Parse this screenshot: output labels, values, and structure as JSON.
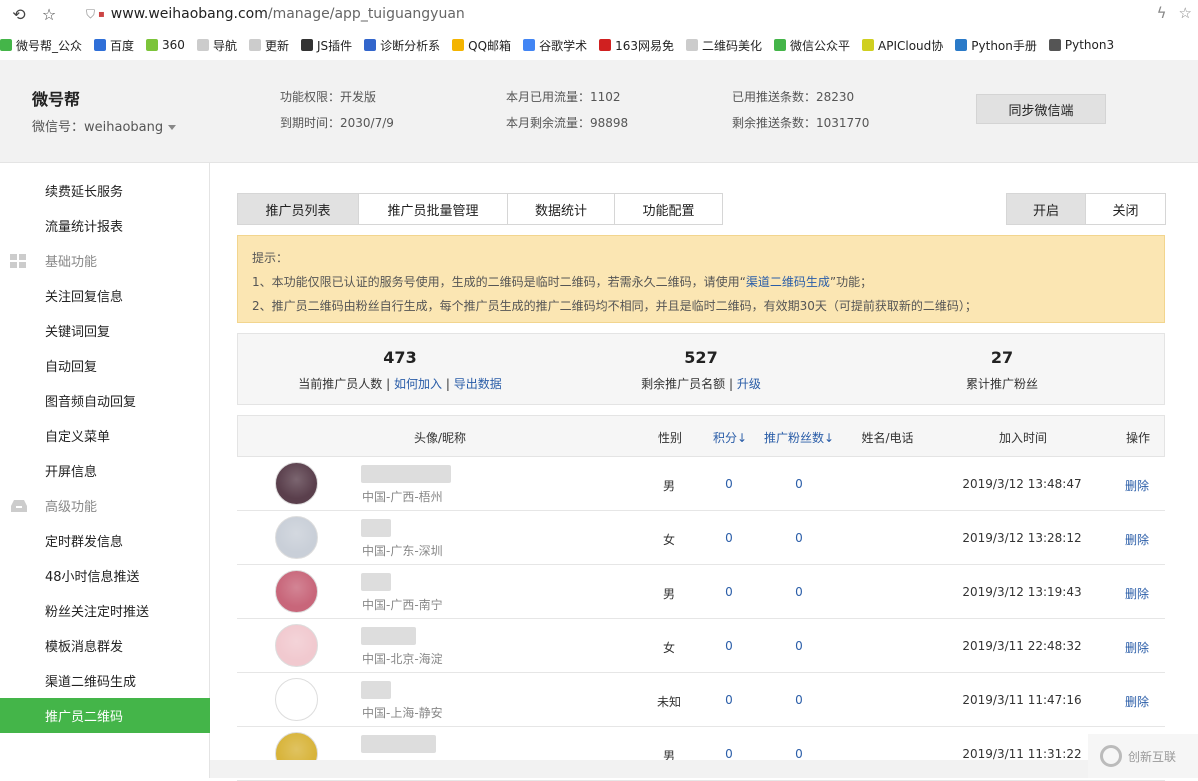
{
  "browser": {
    "url_domain": "www.weihaobang.com",
    "url_path": "/manage/app_tuiguangyuan",
    "bookmarks": [
      {
        "label": "微号帮_公众",
        "color": "#44b549"
      },
      {
        "label": "百度",
        "color": "#2f6fd8"
      },
      {
        "label": "360",
        "color": "#7cc43a"
      },
      {
        "label": "导航",
        "color": "#cccccc"
      },
      {
        "label": "更新",
        "color": "#cccccc"
      },
      {
        "label": "JS插件",
        "color": "#333333"
      },
      {
        "label": "诊断分析系",
        "color": "#3366cc"
      },
      {
        "label": "QQ邮箱",
        "color": "#f4b400"
      },
      {
        "label": "谷歌学术",
        "color": "#4285f4"
      },
      {
        "label": "163网易免",
        "color": "#d02020"
      },
      {
        "label": "二维码美化",
        "color": "#cccccc"
      },
      {
        "label": "微信公众平",
        "color": "#44b549"
      },
      {
        "label": "APICloud协",
        "color": "#cfcf20"
      },
      {
        "label": "Python手册",
        "color": "#2a7ac8"
      },
      {
        "label": "Python3",
        "color": "#555555"
      }
    ]
  },
  "header": {
    "brand": "微号帮",
    "wx_account": "微信号：weihaobang",
    "permission": "功能权限：开发版",
    "expire": "到期时间：2030/7/9",
    "flow_used": "本月已用流量：1102",
    "flow_left": "本月剩余流量：98898",
    "push_used": "已用推送条数：28230",
    "push_left": "剩余推送条数：1031770",
    "sync_button": "同步微信端"
  },
  "sidebar": {
    "items": [
      {
        "label": "续费延长服务",
        "type": "item"
      },
      {
        "label": "流量统计报表",
        "type": "item"
      },
      {
        "label": "基础功能",
        "type": "group",
        "icon": "grid-icon"
      },
      {
        "label": "关注回复信息",
        "type": "item"
      },
      {
        "label": "关键词回复",
        "type": "item"
      },
      {
        "label": "自动回复",
        "type": "item"
      },
      {
        "label": "图音频自动回复",
        "type": "item"
      },
      {
        "label": "自定义菜单",
        "type": "item"
      },
      {
        "label": "开屏信息",
        "type": "item"
      },
      {
        "label": "高级功能",
        "type": "group",
        "icon": "inbox-icon"
      },
      {
        "label": "定时群发信息",
        "type": "item"
      },
      {
        "label": "48小时信息推送",
        "type": "item"
      },
      {
        "label": "粉丝关注定时推送",
        "type": "item"
      },
      {
        "label": "模板消息群发",
        "type": "item"
      },
      {
        "label": "渠道二维码生成",
        "type": "item"
      },
      {
        "label": "推广员二维码",
        "type": "item",
        "active": true
      }
    ]
  },
  "tabs": [
    "推广员列表",
    "推广员批量管理",
    "数据统计",
    "功能配置"
  ],
  "switch": {
    "on": "开启",
    "off": "关闭"
  },
  "notice": {
    "title": "提示：",
    "line1_a": "1、本功能仅限已认证的服务号使用，生成的二维码是临时二维码，若需永久二维码，请使用“",
    "line1_link": "渠道二维码生成",
    "line1_b": "”功能；",
    "line2": "2、推广员二维码由粉丝自行生成，每个推广员生成的推广二维码均不相同，并且是临时二维码，有效期30天（可提前获取新的二维码）；"
  },
  "stats": {
    "current_count": "473",
    "current_label": "当前推广员人数",
    "how_to_join": "如何加入",
    "export": "导出数据",
    "remaining_count": "527",
    "remaining_label": "剩余推广员名额",
    "upgrade": "升级",
    "fans_count": "27",
    "fans_label": "累计推广粉丝",
    "sep": "|"
  },
  "table": {
    "headers": {
      "avatar": "头像/昵称",
      "gender": "性别",
      "points": "积分↓",
      "fans": "推广粉丝数↓",
      "name": "姓名/电话",
      "time": "加入时间",
      "action": "操作"
    },
    "rows": [
      {
        "region": "中国-广西-梧州",
        "gender": "男",
        "points": "0",
        "fans": "0",
        "time": "2019/3/12 13:48:47",
        "action": "删除",
        "avatar_color": "#5a3f4c"
      },
      {
        "region": "中国-广东-深圳",
        "gender": "女",
        "points": "0",
        "fans": "0",
        "time": "2019/3/12 13:28:12",
        "action": "删除",
        "avatar_color": "#c9cfd8"
      },
      {
        "region": "中国-广西-南宁",
        "gender": "男",
        "points": "0",
        "fans": "0",
        "time": "2019/3/12 13:19:43",
        "action": "删除",
        "avatar_color": "#c8667a"
      },
      {
        "region": "中国-北京-海淀",
        "gender": "女",
        "points": "0",
        "fans": "0",
        "time": "2019/3/11 22:48:32",
        "action": "删除",
        "avatar_color": "#f1c9cf"
      },
      {
        "region": "中国-上海-静安",
        "gender": "未知",
        "points": "0",
        "fans": "0",
        "time": "2019/3/11 11:47:16",
        "action": "删除",
        "avatar_color": "#ffffff"
      },
      {
        "region": "",
        "gender": "男",
        "points": "0",
        "fans": "0",
        "time": "2019/3/11 11:31:22",
        "action": "",
        "avatar_color": "#d8b43a"
      }
    ]
  },
  "watermark": "创新互联"
}
